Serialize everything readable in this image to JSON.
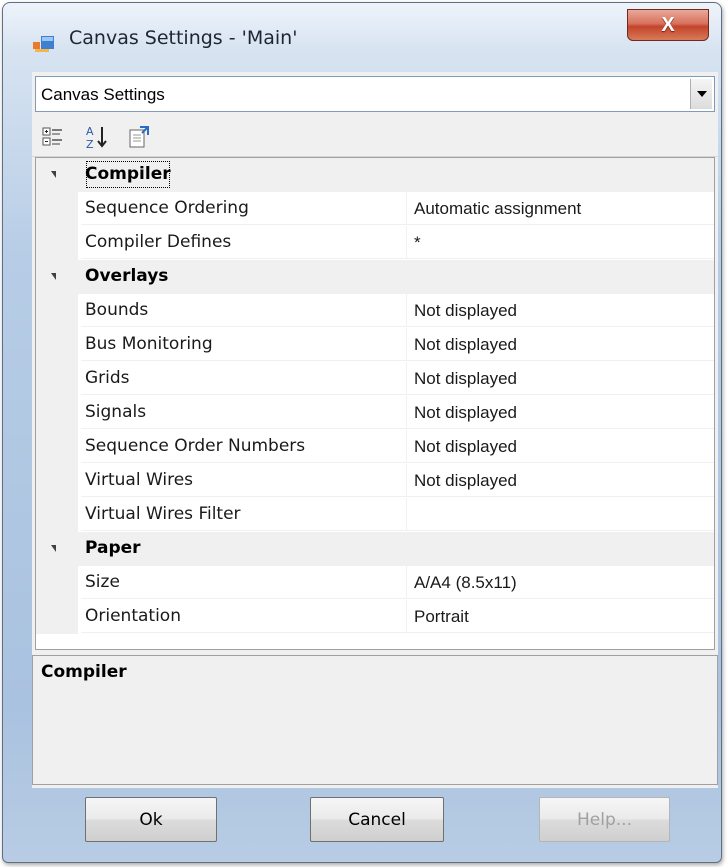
{
  "window": {
    "title": "Canvas Settings - 'Main'",
    "close_glyph": "X",
    "app_icon": "canvas-settings-app-icon"
  },
  "selector": {
    "value": "Canvas Settings"
  },
  "toolbar": {
    "items": [
      "categorized-view-icon",
      "alphabetical-sort-icon",
      "property-pages-icon"
    ]
  },
  "grid": {
    "categories": [
      {
        "label": "Compiler",
        "properties": [
          {
            "name": "Sequence Ordering",
            "value": "Automatic assignment"
          },
          {
            "name": "Compiler Defines",
            "value": "*"
          }
        ]
      },
      {
        "label": "Overlays",
        "properties": [
          {
            "name": "Bounds",
            "value": "Not displayed"
          },
          {
            "name": "Bus Monitoring",
            "value": "Not displayed"
          },
          {
            "name": "Grids",
            "value": "Not displayed"
          },
          {
            "name": "Signals",
            "value": "Not displayed"
          },
          {
            "name": "Sequence Order Numbers",
            "value": "Not displayed"
          },
          {
            "name": "Virtual Wires",
            "value": "Not displayed"
          },
          {
            "name": "Virtual Wires Filter",
            "value": ""
          }
        ]
      },
      {
        "label": "Paper",
        "properties": [
          {
            "name": "Size",
            "value": "A/A4 (8.5x11)"
          },
          {
            "name": "Orientation",
            "value": "Portrait"
          }
        ]
      }
    ]
  },
  "help": {
    "title": "Compiler"
  },
  "buttons": {
    "ok": "Ok",
    "cancel": "Cancel",
    "help": "Help..."
  }
}
